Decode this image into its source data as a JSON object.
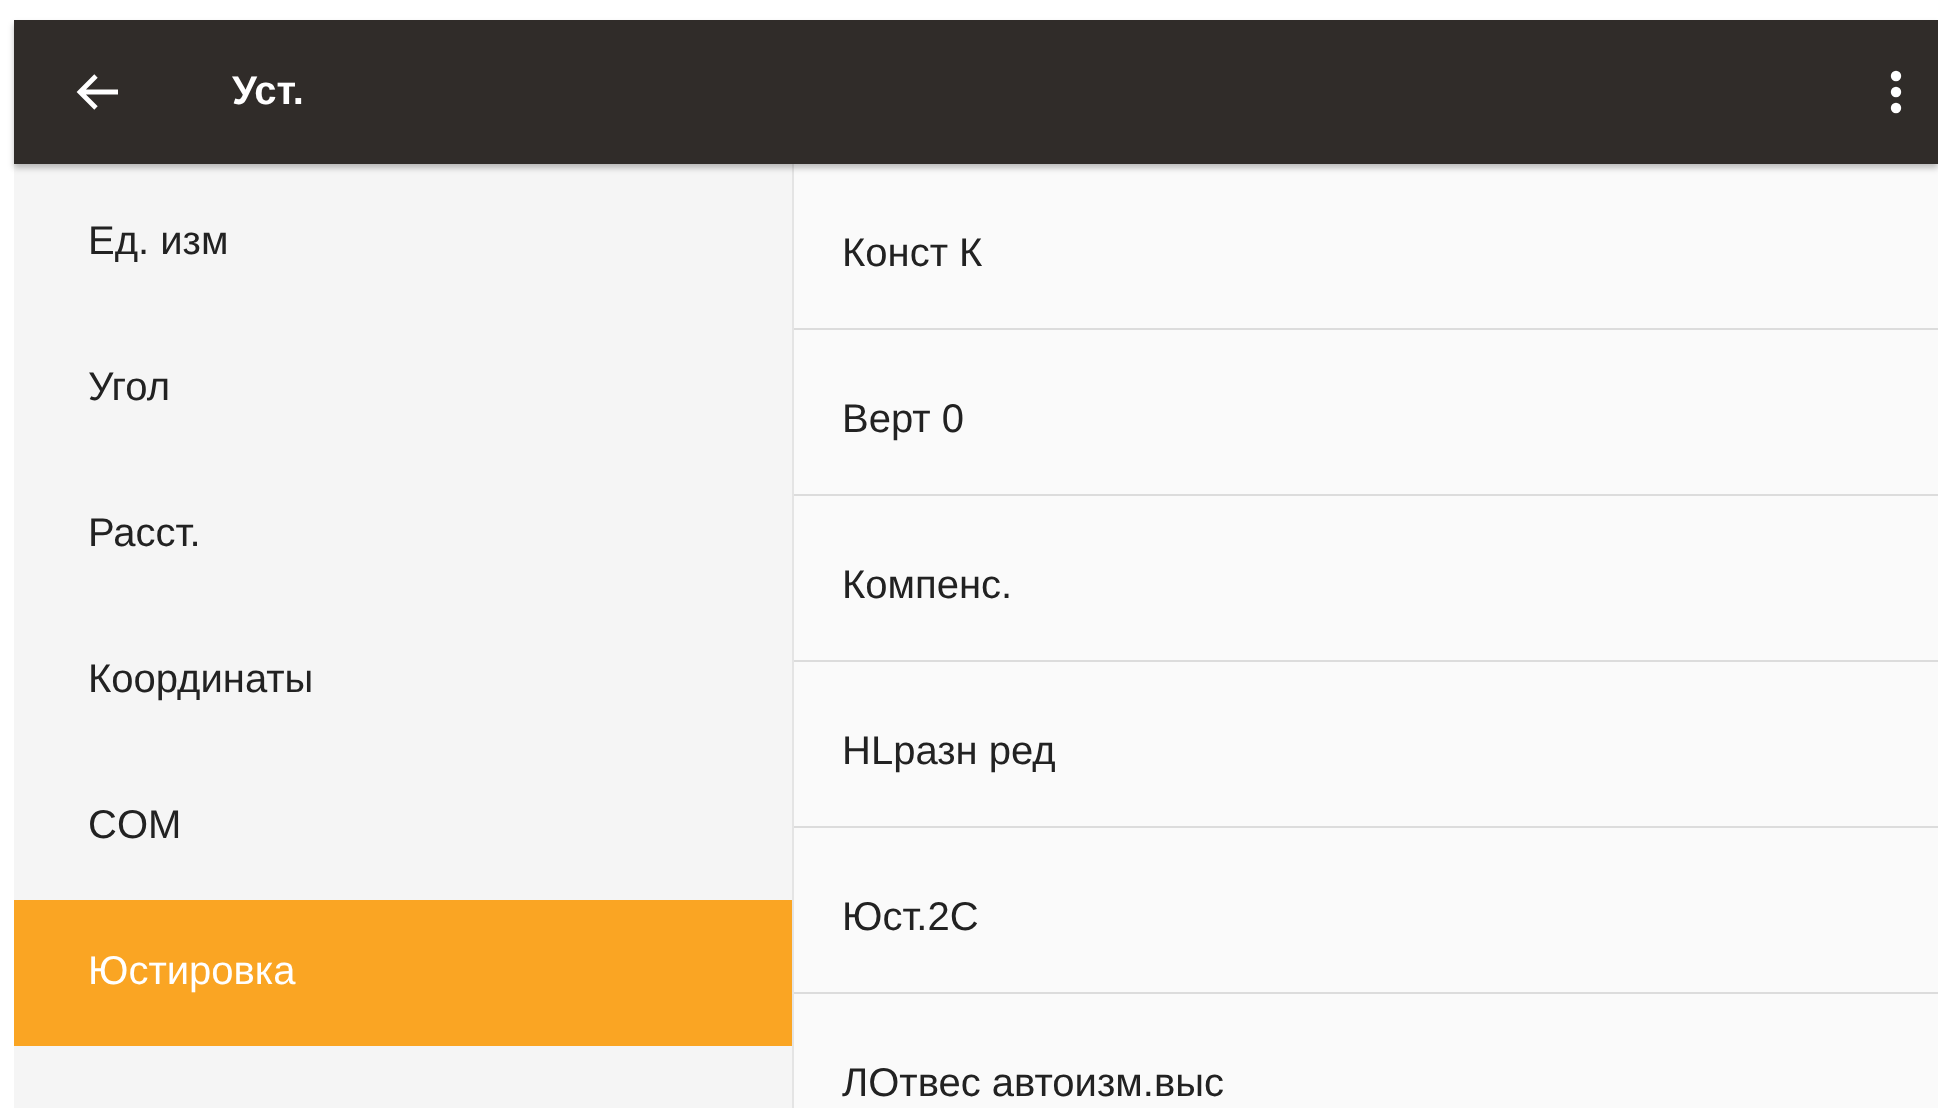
{
  "app_bar": {
    "title": "Уст."
  },
  "categories": [
    {
      "label": "Ед. изм",
      "selected": false
    },
    {
      "label": "Угол",
      "selected": false
    },
    {
      "label": "Расст.",
      "selected": false
    },
    {
      "label": "Координаты",
      "selected": false
    },
    {
      "label": "COM",
      "selected": false
    },
    {
      "label": "Юстировка",
      "selected": true
    }
  ],
  "settings": [
    "Конст К",
    "Верт 0",
    "Компенс.",
    "HLразн ред",
    "Юст.2С",
    "ЛОтвес автоизм.выс"
  ]
}
